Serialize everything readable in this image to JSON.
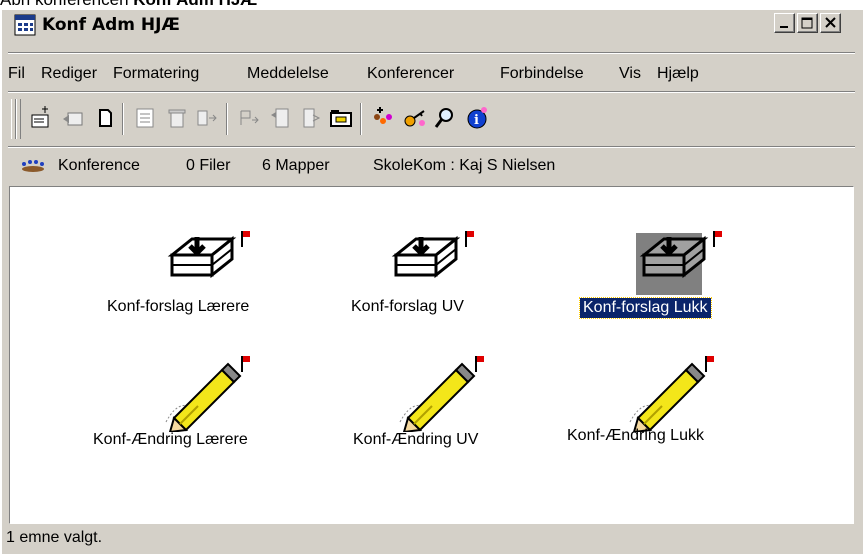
{
  "caption": {
    "prefix": "Åbn konferencen ",
    "bold": "Konf Adm HJÆ"
  },
  "window": {
    "title": "Konf Adm HJÆ"
  },
  "window_buttons": [
    "minimize",
    "maximize",
    "close"
  ],
  "menu": [
    "Fil",
    "Rediger",
    "Formatering",
    "Meddelelse",
    "Konferencer",
    "Forbindelse",
    "Vis",
    "Hjælp"
  ],
  "toolbar": {
    "icons": [
      "new-message-icon",
      "reply-icon",
      "new-document-icon",
      "print-icon",
      "delete-icon",
      "forward-icon",
      "next-unread-icon",
      "thread-icon",
      "move-icon",
      "open-folder-icon",
      "members-icon",
      "key-icon",
      "search-icon",
      "info-icon"
    ]
  },
  "path": {
    "type": "Konference",
    "files": "0 Filer",
    "folders": "6 Mapper",
    "location": "SkoleKom : Kaj S Nielsen"
  },
  "items": [
    {
      "label": "Konf-forslag Lærere",
      "icon": "inbox-tray-icon",
      "selected": false
    },
    {
      "label": "Konf-forslag UV",
      "icon": "inbox-tray-icon",
      "selected": false
    },
    {
      "label": "Konf-forslag Lukk",
      "icon": "inbox-tray-icon",
      "selected": true
    },
    {
      "label": "Konf-Ændring Lærere",
      "icon": "pencil-icon",
      "selected": false
    },
    {
      "label": "Konf-Ændring UV",
      "icon": "pencil-icon",
      "selected": false
    },
    {
      "label": "Konf-Ændring Lukk",
      "icon": "pencil-icon",
      "selected": false
    }
  ],
  "status": {
    "text": "1 emne valgt."
  },
  "colors": {
    "selection": "#0a246a",
    "flag": "#e00000",
    "chrome": "#d4d0c8",
    "pencil": "#f3e61a"
  }
}
